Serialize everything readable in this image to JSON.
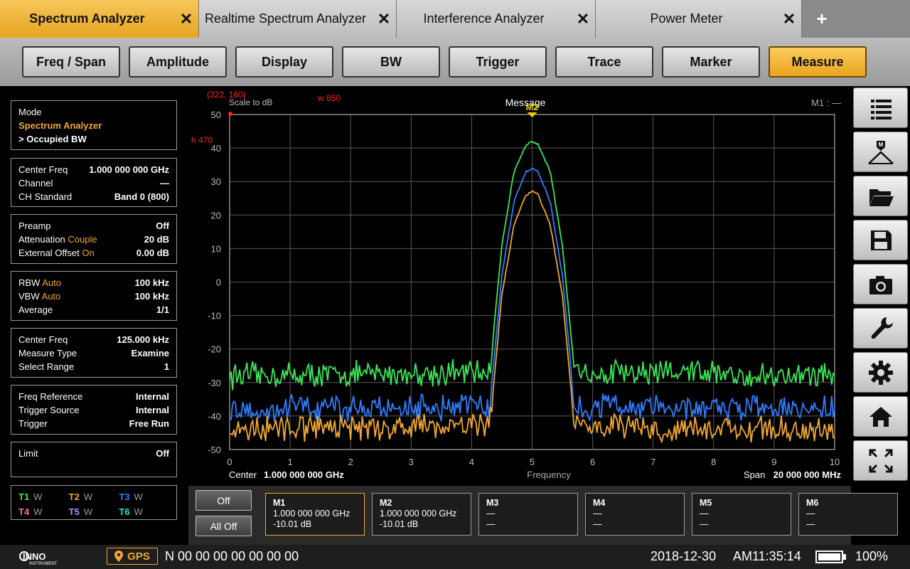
{
  "tabs": [
    {
      "label": "Spectrum Analyzer",
      "active": true
    },
    {
      "label": "Realtime Spectrum Analyzer",
      "active": false
    },
    {
      "label": "Interference Analyzer",
      "active": false
    },
    {
      "label": "Power Meter",
      "active": false
    }
  ],
  "tab_close_glyph": "✕",
  "add_tab_glyph": "+",
  "func_buttons": [
    "Freq / Span",
    "Amplitude",
    "Display",
    "BW",
    "Trigger",
    "Trace",
    "Marker",
    "Measure"
  ],
  "func_active": "Measure",
  "left": {
    "mode": {
      "label": "Mode",
      "value": "Spectrum Analyzer",
      "sub": "> Occupied BW"
    },
    "freq": [
      {
        "k": "Center Freq",
        "v": "1.000 000 000 GHz"
      },
      {
        "k": "Channel",
        "v": "—"
      },
      {
        "k": "CH Standard",
        "v": "Band 0 (800)"
      }
    ],
    "amp": [
      {
        "k": "Preamp",
        "s": "",
        "v": "Off"
      },
      {
        "k": "Attenuation",
        "s": "Couple",
        "v": "20 dB"
      },
      {
        "k": "External Offset",
        "s": "On",
        "v": "0.00 dB"
      }
    ],
    "bw": [
      {
        "k": "RBW",
        "s": "Auto",
        "v": "100 kHz"
      },
      {
        "k": "VBW",
        "s": "Auto",
        "v": "100 kHz"
      },
      {
        "k": "Average",
        "s": "",
        "v": "1/1"
      }
    ],
    "meas": [
      {
        "k": "Center Freq",
        "v": "125.000 kHz"
      },
      {
        "k": "Measure Type",
        "v": "Examine"
      },
      {
        "k": "Select Range",
        "v": "1"
      }
    ],
    "trig": [
      {
        "k": "Freq Reference",
        "v": "Internal"
      },
      {
        "k": "Trigger Source",
        "v": "Internal"
      },
      {
        "k": "Trigger",
        "v": "Free Run"
      }
    ],
    "limit": {
      "k": "Limit",
      "v": "Off"
    },
    "traces": [
      {
        "name": "T1",
        "mode": "W",
        "color": "#39e65a"
      },
      {
        "name": "T2",
        "mode": "W",
        "color": "#f0a830"
      },
      {
        "name": "T3",
        "mode": "W",
        "color": "#2f7dff"
      },
      {
        "name": "T4",
        "mode": "W",
        "color": "#ff6b8a"
      },
      {
        "name": "T5",
        "mode": "W",
        "color": "#b28cff"
      },
      {
        "name": "T6",
        "mode": "W",
        "color": "#20e0e0"
      }
    ]
  },
  "plot": {
    "cursor_readout": "(322, 160)",
    "scale_label": "Scale to dB",
    "w_readout": "w  850",
    "h_readout": "h  470",
    "message": "Message",
    "marker_readout": "M1 : —",
    "marker_label": "M2",
    "center_label": "Center",
    "center_value": "1.000 000 000 GHz",
    "x_axis_label": "Frequency",
    "span_label": "Span",
    "span_value": "20 000 000 MHz"
  },
  "chart_data": {
    "type": "line",
    "x_ticks": [
      "0",
      "1",
      "2",
      "3",
      "4",
      "5",
      "6",
      "7",
      "8",
      "9",
      "10"
    ],
    "y_ticks": [
      "50",
      "40",
      "30",
      "20",
      "10",
      "0",
      "-10",
      "-20",
      "-30",
      "-40",
      "-50"
    ],
    "xlim": [
      0,
      10
    ],
    "ylim": [
      -50,
      50
    ],
    "grid": true,
    "series": [
      {
        "color": "#39e65a",
        "noise_floor": -28,
        "peak": 42,
        "x": [
          0,
          4.3,
          4.5,
          4.7,
          4.9,
          5.0,
          5.1,
          5.3,
          5.5,
          5.7,
          10
        ],
        "y": [
          -28,
          -27,
          11,
          33,
          41,
          42,
          41,
          33,
          11,
          -27,
          -28
        ]
      },
      {
        "color": "#2f7dff",
        "noise_floor": -38,
        "peak": 34,
        "x": [
          0,
          4.3,
          4.5,
          4.7,
          4.9,
          5.0,
          5.1,
          5.3,
          5.5,
          5.7,
          10
        ],
        "y": [
          -38,
          -37,
          2,
          24,
          33,
          34,
          33,
          24,
          2,
          -37,
          -38
        ]
      },
      {
        "color": "#f0a830",
        "noise_floor": -44,
        "peak": 27,
        "x": [
          0,
          4.3,
          4.5,
          4.7,
          4.9,
          5.0,
          5.1,
          5.3,
          5.5,
          5.7,
          10
        ],
        "y": [
          -44,
          -43,
          -4,
          17,
          26,
          27,
          26,
          17,
          -4,
          -43,
          -44
        ]
      }
    ],
    "marker": {
      "name": "M2",
      "x": 5.0,
      "color": "#f0d000"
    }
  },
  "markers_strip": {
    "off_label": "Off",
    "all_off_label": "All Off",
    "markers": [
      {
        "name": "M1",
        "line1": "1.000 000 000 GHz",
        "line2": "-10.01 dB",
        "active": true
      },
      {
        "name": "M2",
        "line1": "1.000 000 000 GHz",
        "line2": "-10.01 dB",
        "active": false
      },
      {
        "name": "M3",
        "line1": "—",
        "line2": "—",
        "active": false
      },
      {
        "name": "M4",
        "line1": "—",
        "line2": "—",
        "active": false
      },
      {
        "name": "M5",
        "line1": "—",
        "line2": "—",
        "active": false
      },
      {
        "name": "M6",
        "line1": "—",
        "line2": "—",
        "active": false
      }
    ]
  },
  "right_icons": [
    "list-icon",
    "marker-peak-icon",
    "folder-open-icon",
    "save-icon",
    "camera-icon",
    "wrench-icon",
    "gear-icon",
    "home-icon",
    "fullscreen-icon"
  ],
  "status": {
    "logo_text": "INNO",
    "logo_sub": "INSTRUMENT",
    "gps_label": "GPS",
    "coordinates": "N 00 00 00  00 00 00 00",
    "date": "2018-12-30",
    "time": "AM11:35:14",
    "battery": "100%",
    "battery_level": 1.0
  }
}
